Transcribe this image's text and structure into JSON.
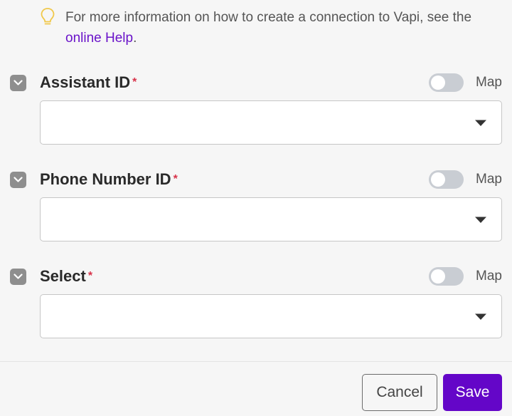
{
  "info": {
    "text_before": "For more information on how to create a connection to Vapi, see the ",
    "link_text": "online Help",
    "text_after": "."
  },
  "fields": [
    {
      "label": "Assistant ID",
      "required_mark": "*",
      "map_label": "Map",
      "map_enabled": false,
      "value": ""
    },
    {
      "label": "Phone Number ID",
      "required_mark": "*",
      "map_label": "Map",
      "map_enabled": false,
      "value": ""
    },
    {
      "label": "Select",
      "required_mark": "*",
      "map_label": "Map",
      "map_enabled": false,
      "value": ""
    }
  ],
  "footer": {
    "cancel_label": "Cancel",
    "save_label": "Save"
  },
  "colors": {
    "accent": "#6406c8",
    "link": "#6a13c9",
    "required": "#d8334a",
    "hint_icon": "#f0c84a"
  },
  "icons": {
    "info": "lightbulb-icon",
    "collapse": "chevron-down-icon",
    "dropdown": "caret-down-icon"
  }
}
